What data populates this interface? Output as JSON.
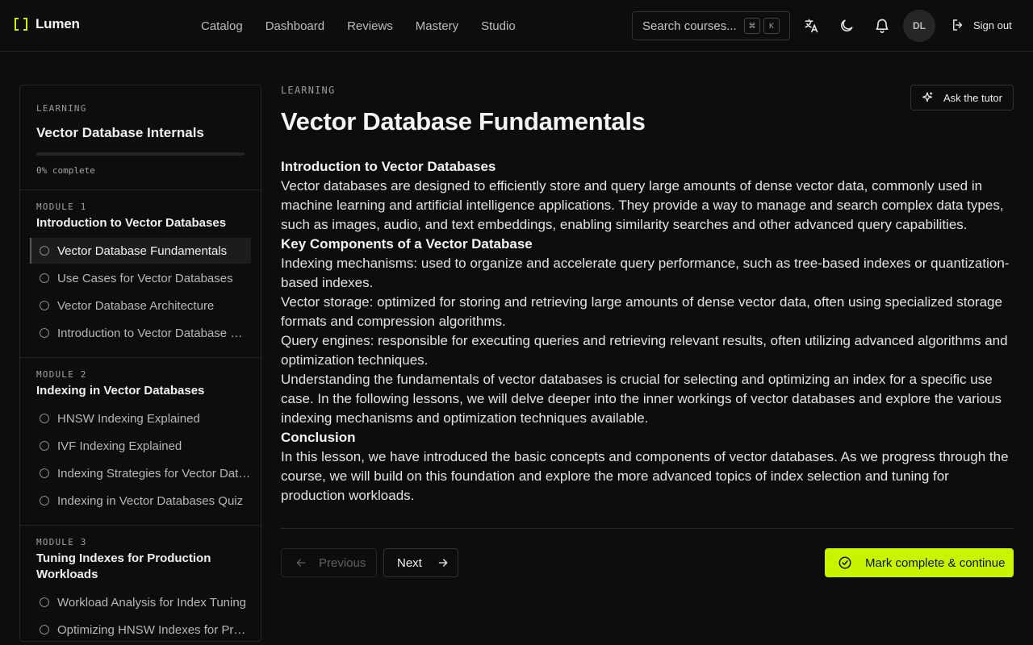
{
  "header": {
    "brand": "Lumen",
    "nav": [
      "Catalog",
      "Dashboard",
      "Reviews",
      "Mastery",
      "Studio"
    ],
    "search": {
      "placeholder": "Search courses...",
      "kbd": [
        "⌘",
        "K"
      ]
    },
    "avatar_initials": "DL",
    "signout_label": "Sign out",
    "icons": [
      "translate-icon",
      "moon-icon",
      "bell-icon",
      "logout-icon"
    ]
  },
  "sidebar": {
    "overline": "LEARNING",
    "course_title": "Vector Database Internals",
    "progress": {
      "percent": 0,
      "label": "0% complete"
    },
    "modules": [
      {
        "label": "MODULE 1",
        "title": "Introduction to Vector Databases",
        "lessons": [
          {
            "title": "Vector Database Fundamentals",
            "active": true
          },
          {
            "title": "Use Cases for Vector Databases",
            "active": false
          },
          {
            "title": "Vector Database Architecture",
            "active": false
          },
          {
            "title": "Introduction to Vector Database Quiz",
            "active": false
          }
        ]
      },
      {
        "label": "MODULE 2",
        "title": "Indexing in Vector Databases",
        "lessons": [
          {
            "title": "HNSW Indexing Explained",
            "active": false
          },
          {
            "title": "IVF Indexing Explained",
            "active": false
          },
          {
            "title": "Indexing Strategies for Vector Databases",
            "active": false
          },
          {
            "title": "Indexing in Vector Databases Quiz",
            "active": false
          }
        ]
      },
      {
        "label": "MODULE 3",
        "title": "Tuning Indexes for Production Workloads",
        "lessons": [
          {
            "title": "Workload Analysis for Index Tuning",
            "active": false
          },
          {
            "title": "Optimizing HNSW Indexes for Production",
            "active": false
          }
        ]
      }
    ]
  },
  "main": {
    "overline": "LEARNING",
    "title": "Vector Database Fundamentals",
    "tutor_label": "Ask the tutor",
    "content": [
      {
        "type": "h",
        "text": "Introduction to Vector Databases"
      },
      {
        "type": "p",
        "text": "Vector databases are designed to efficiently store and query large amounts of dense vector data, commonly used in machine learning and artificial intelligence applications. They provide a way to manage and search complex data types, such as images, audio, and text embeddings, enabling similarity searches and other advanced query capabilities."
      },
      {
        "type": "h",
        "text": "Key Components of a Vector Database"
      },
      {
        "type": "p",
        "text": "Indexing mechanisms: used to organize and accelerate query performance, such as tree-based indexes or quantization-based indexes."
      },
      {
        "type": "p",
        "text": "Vector storage: optimized for storing and retrieving large amounts of dense vector data, often using specialized storage formats and compression algorithms."
      },
      {
        "type": "p",
        "text": "Query engines: responsible for executing queries and retrieving relevant results, often utilizing advanced algorithms and optimization techniques."
      },
      {
        "type": "p",
        "text": "Understanding the fundamentals of vector databases is crucial for selecting and optimizing an index for a specific use case. In the following lessons, we will delve deeper into the inner workings of vector databases and explore the various indexing mechanisms and optimization techniques available."
      },
      {
        "type": "h",
        "text": "Conclusion"
      },
      {
        "type": "p",
        "text": "In this lesson, we have introduced the basic concepts and components of vector databases. As we progress through the course, we will build on this foundation and explore the more advanced topics of index selection and tuning for production workloads."
      }
    ],
    "prev_label": "Previous",
    "next_label": "Next",
    "complete_label": "Mark complete & continue"
  },
  "colors": {
    "accent": "#c8f400",
    "background": "#0d0d0d",
    "border": "#262626"
  }
}
